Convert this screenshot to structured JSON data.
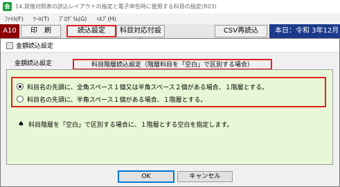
{
  "window": {
    "icon_label": "会",
    "title": "14.貸借対照表の読込レイアウトの指定と電子申告時に使用する科目の指定(R03)"
  },
  "menu": [
    "ﾌｧｲﾙ(F)",
    "ﾂｰﾙ(T)",
    "ﾌﾟﾛｸﾞﾗﾑ(G)",
    "ﾍﾙﾌﾟ(H)"
  ],
  "toolbar": {
    "code": "A10",
    "print": "印　刷",
    "read_settings": "読込設定",
    "subject_table_settings": "科目対応付設定",
    "csv_reread": "CSV再読込",
    "date": "本日：令和 3年12月"
  },
  "dialog": {
    "title": "金額読込設定",
    "tab_amount": "金額読込設定",
    "tab_hierarchy": "科目階層読込設定（階層科目を「空白」で区別する場合）",
    "options": [
      "科目名の先頭に、全角スペース１個又は半角スペース２個がある場合、１階層とする。",
      "科目名の先頭に、半角スペース１個がある場合、１階層とする。"
    ],
    "selected_option": 0,
    "note_icon": "spade-icon",
    "note": "科目階層を「空白」で区別する場合に、１階層とする空白を指定します。",
    "ok": "OK",
    "cancel": "キャンセル"
  }
}
